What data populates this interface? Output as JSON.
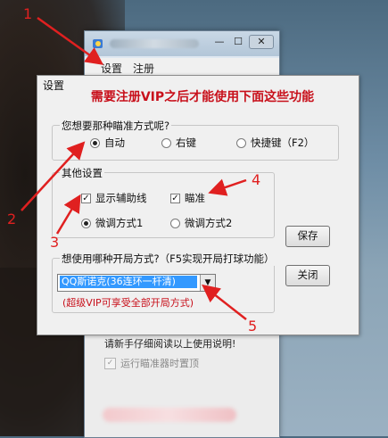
{
  "main_window": {
    "close_symbol": "✕",
    "minimize_symbol": "—",
    "maximize_symbol": "☐",
    "menu": [
      "设置",
      "注册"
    ],
    "notice": "请新手仔细阅读以上使用说明!",
    "topmost_label": "运行瞄准器时置顶",
    "topmost_checked": true
  },
  "dialog": {
    "caption": "设置",
    "vip_banner": "需要注册VIP之后才能使用下面这些功能",
    "aim_group": {
      "label": "您想要那种瞄准方式呢?",
      "options": [
        "自动",
        "右键",
        "快捷键（F2）"
      ],
      "selected": "自动"
    },
    "other_group": {
      "label": "其他设置",
      "show_aux_line": "显示辅助线",
      "show_aux_line_checked": true,
      "aim": "瞄准",
      "aim_checked": true,
      "fine_tune_1": "微调方式1",
      "fine_tune_2": "微调方式2",
      "fine_tune_selected": "微调方式1"
    },
    "start_group": {
      "label": "想使用哪种开局方式?（F5实现开局打球功能）",
      "selected_value": "QQ斯诺克(36连环一杆清)",
      "vip_note": "(超级VIP可享受全部开局方式)"
    },
    "save_button": "保存",
    "close_button": "关闭"
  },
  "annotations": [
    "1",
    "2",
    "3",
    "4",
    "5"
  ],
  "colors": {
    "annotation": "#e02020",
    "vip_text": "#c8101b",
    "selection": "#3399ff"
  },
  "icons": {
    "app": "app-icon",
    "dropdown": "chevron-down-icon"
  }
}
